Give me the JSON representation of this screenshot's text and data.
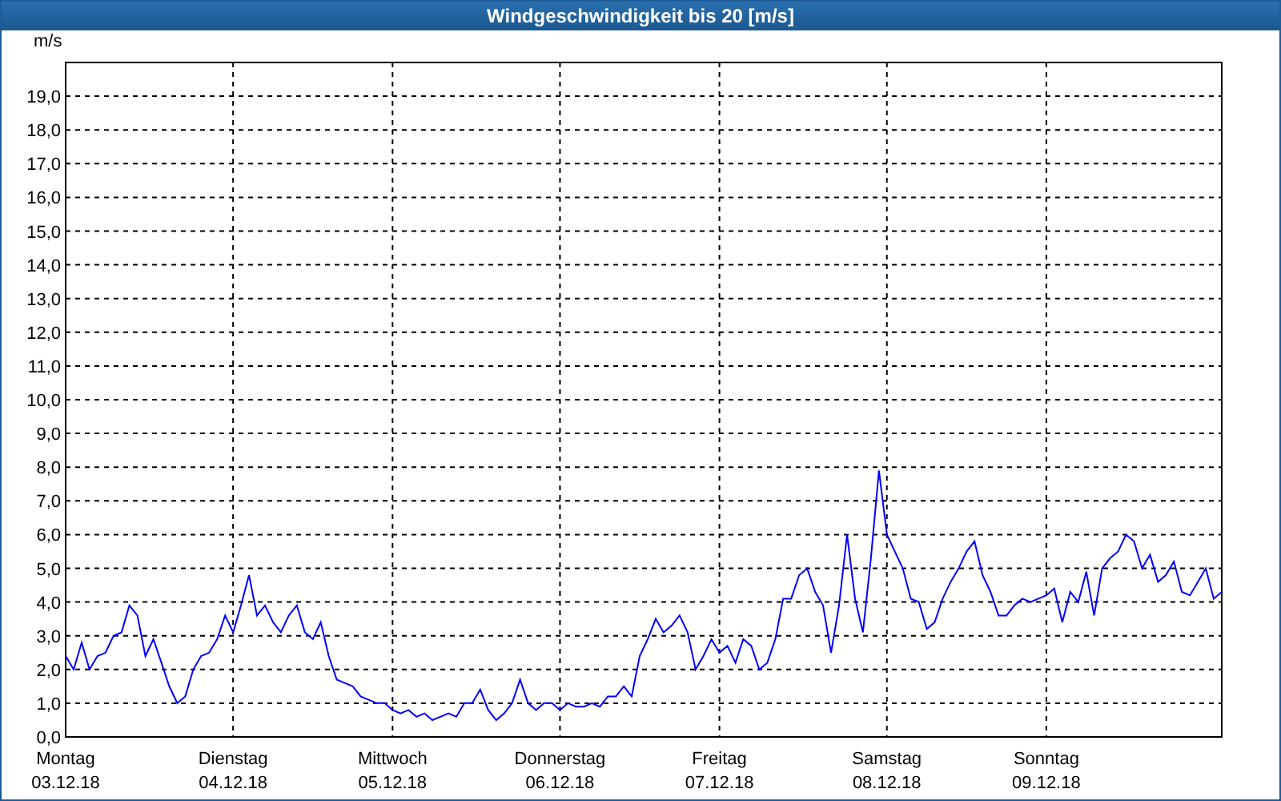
{
  "window": {
    "title": "Windgeschwindigkeit bis 20 [m/s]"
  },
  "chart": {
    "chart_data": {
      "type": "line",
      "ylabel": "m/s",
      "ylim": [
        0,
        20
      ],
      "grid": true,
      "yticks": [
        {
          "value": 0,
          "label": "0,0"
        },
        {
          "value": 1,
          "label": "1,0"
        },
        {
          "value": 2,
          "label": "2,0"
        },
        {
          "value": 3,
          "label": "3,0"
        },
        {
          "value": 4,
          "label": "4,0"
        },
        {
          "value": 5,
          "label": "5,0"
        },
        {
          "value": 6,
          "label": "6,0"
        },
        {
          "value": 7,
          "label": "7,0"
        },
        {
          "value": 8,
          "label": "8,0"
        },
        {
          "value": 9,
          "label": "9,0"
        },
        {
          "value": 10,
          "label": "10,0"
        },
        {
          "value": 11,
          "label": "11,0"
        },
        {
          "value": 12,
          "label": "12,0"
        },
        {
          "value": 13,
          "label": "13,0"
        },
        {
          "value": 14,
          "label": "14,0"
        },
        {
          "value": 15,
          "label": "15,0"
        },
        {
          "value": 16,
          "label": "16,0"
        },
        {
          "value": 17,
          "label": "17,0"
        },
        {
          "value": 18,
          "label": "18,0"
        },
        {
          "value": 19,
          "label": "19,0"
        }
      ],
      "categories": [
        "Montag 03.12.18",
        null,
        null,
        null,
        null,
        null,
        null,
        null,
        null,
        null,
        null,
        null,
        null,
        null,
        null,
        null,
        null,
        null,
        null,
        null,
        null,
        "Dienstag 04.12.18",
        null,
        null,
        null,
        null,
        null,
        null,
        null,
        null,
        null,
        null,
        null,
        null,
        null,
        null,
        null,
        null,
        null,
        null,
        null,
        "Mittwoch 05.12.18",
        null,
        null,
        null,
        null,
        null,
        null,
        null,
        null,
        null,
        null,
        null,
        null,
        null,
        null,
        null,
        null,
        null,
        null,
        null,
        null,
        "Donnerstag 06.12.18",
        null,
        null,
        null,
        null,
        null,
        null,
        null,
        null,
        null,
        null,
        null,
        null,
        null,
        null,
        null,
        null,
        null,
        null,
        null,
        "Freitag 07.12.18",
        null,
        null,
        null,
        null,
        null,
        null,
        null,
        null,
        null,
        null,
        null,
        null,
        null,
        null,
        null,
        null,
        null,
        null,
        null,
        null,
        "Samstag 08.12.18",
        null,
        null,
        null,
        null,
        null,
        null,
        null,
        null,
        null,
        null,
        null,
        null,
        null,
        null,
        null,
        null,
        null,
        null,
        null,
        "Sonntag 09.12.18",
        null,
        null,
        null,
        null,
        null,
        null,
        null,
        null,
        null,
        null,
        null,
        null,
        null,
        null,
        null,
        null,
        null,
        null,
        null,
        null,
        null,
        null
      ],
      "series": [
        {
          "color": "#0000ff",
          "values": [
            2.4,
            2.0,
            2.8,
            2.0,
            2.4,
            2.5,
            3.0,
            3.1,
            3.9,
            3.6,
            2.4,
            2.9,
            2.2,
            1.5,
            1.0,
            1.2,
            2.0,
            2.4,
            2.5,
            2.9,
            3.6,
            3.1,
            3.9,
            4.8,
            3.6,
            3.9,
            3.4,
            3.1,
            3.6,
            3.9,
            3.1,
            2.9,
            3.4,
            2.4,
            1.7,
            1.6,
            1.5,
            1.2,
            1.1,
            1.0,
            1.0,
            0.8,
            0.7,
            0.8,
            0.6,
            0.7,
            0.5,
            0.6,
            0.7,
            0.6,
            1.0,
            1.0,
            1.4,
            0.8,
            0.5,
            0.7,
            1.0,
            1.7,
            1.0,
            0.8,
            1.0,
            1.0,
            0.8,
            1.0,
            0.9,
            0.9,
            1.0,
            0.9,
            1.2,
            1.2,
            1.5,
            1.2,
            2.4,
            2.9,
            3.5,
            3.1,
            3.3,
            3.6,
            3.1,
            2.0,
            2.4,
            2.9,
            2.5,
            2.7,
            2.2,
            2.9,
            2.7,
            2.0,
            2.2,
            2.9,
            4.1,
            4.1,
            4.8,
            5.0,
            4.3,
            3.9,
            2.5,
            3.9,
            6.0,
            4.1,
            3.1,
            5.3,
            7.9,
            6.0,
            5.5,
            5.0,
            4.1,
            4.0,
            3.2,
            3.4,
            4.1,
            4.6,
            5.0,
            5.5,
            5.8,
            4.8,
            4.3,
            3.6,
            3.6,
            3.9,
            4.1,
            4.0,
            4.1,
            4.2,
            4.4,
            3.4,
            4.3,
            4.0,
            4.9,
            3.6,
            5.0,
            5.3,
            5.5,
            6.0,
            5.8,
            5.0,
            5.4,
            4.6,
            4.8,
            5.2,
            4.3,
            4.2,
            4.6,
            5.0,
            4.1,
            4.3
          ]
        }
      ]
    }
  }
}
